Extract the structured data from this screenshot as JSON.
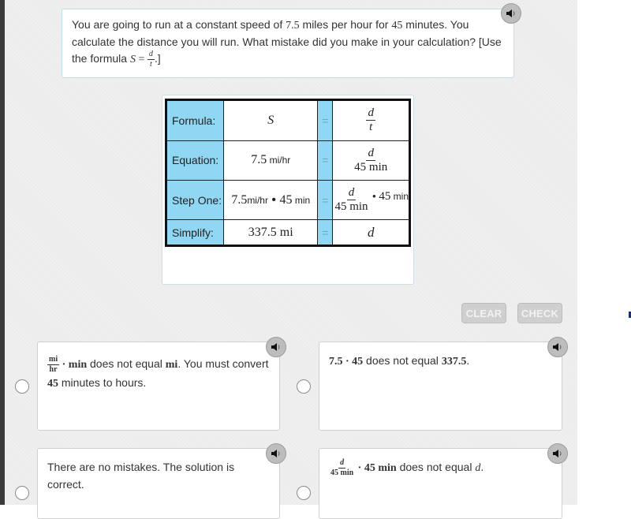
{
  "question": {
    "text_part1": "You are going to run at a constant speed of ",
    "speed": "7.5",
    "text_part2": " miles per hour for ",
    "minutes": "45",
    "text_part3": " minutes. You calculate the distance you will run. What mistake did you make in your calculation? [Use the formula ",
    "formula_lhs": "S",
    "formula_eq": " = ",
    "formula_num": "d",
    "formula_den": "t",
    "text_part4": ".]",
    "audio_icon": "speaker-icon"
  },
  "table": {
    "rows": [
      {
        "label": "Formula:",
        "lhs": "S",
        "eq": "=",
        "rhs_num": "d",
        "rhs_den": "t"
      },
      {
        "label": "Equation:",
        "lhs_value": "7.5",
        "lhs_unit": " mi/hr",
        "eq": "=",
        "rhs_num": "d",
        "rhs_den": "45 min"
      },
      {
        "label": "Step One:",
        "lhs_value1": "7.5",
        "lhs_unit1": "mi/hr",
        "lhs_dot": " • ",
        "lhs_value2": "45",
        "lhs_unit2": " min",
        "eq": "=",
        "rhs_num": "d",
        "rhs_den": "45 min",
        "rhs_tail_dot": " • ",
        "rhs_tail_value": "45",
        "rhs_tail_unit": " min"
      },
      {
        "label": "Simplify:",
        "lhs": "337.5 mi",
        "eq": "=",
        "rhs": "d"
      }
    ]
  },
  "buttons": {
    "clear": "CLEAR",
    "check": "CHECK"
  },
  "choices": [
    {
      "frac_num": "mi",
      "frac_den": "hr",
      "math1": " · min",
      "text1": " does not equal ",
      "math2": "mi",
      "text2": ". You must convert ",
      "math3": "45",
      "text3": " minutes to hours."
    },
    {
      "math1": "7.5 · 45",
      "text1": " does not equal ",
      "math2": "337.5",
      "text2": "."
    },
    {
      "text1": "There are no mistakes. The solution is correct."
    },
    {
      "frac_num": "d",
      "frac_den": "45 min",
      "math1": " · 45 min",
      "text1": " does not equal ",
      "math2": "d",
      "text2": "."
    }
  ]
}
